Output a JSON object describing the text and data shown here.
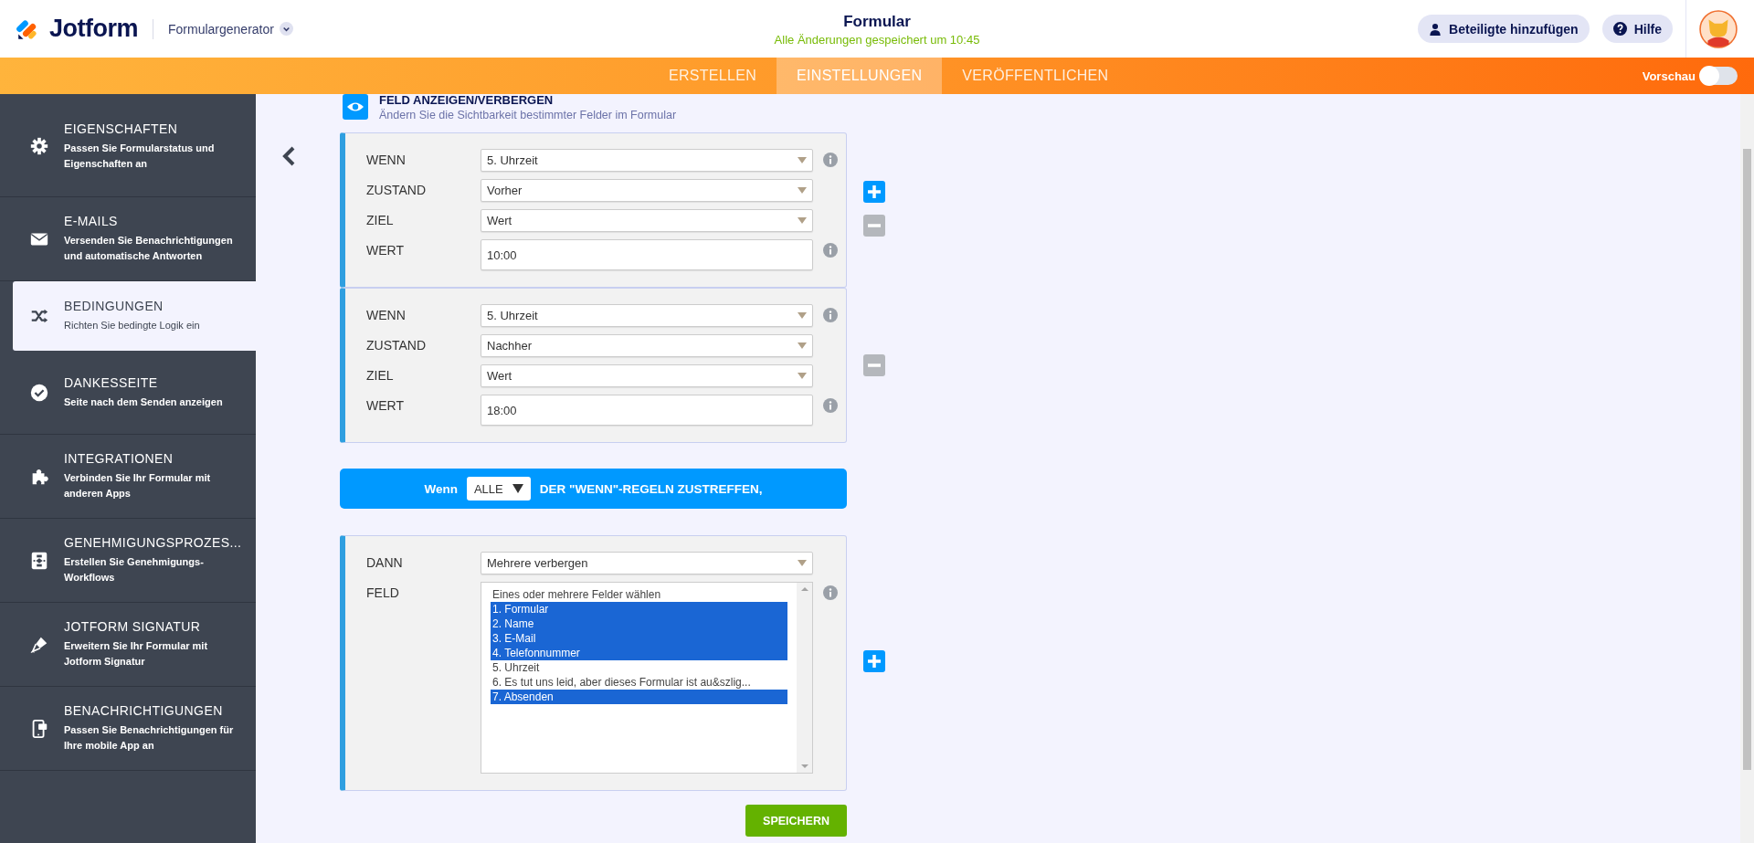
{
  "header": {
    "logo": "Jotform",
    "product": "Formulargenerator",
    "title": "Formular",
    "saved_status": "Alle Änderungen gespeichert um 10:45",
    "buttons": [
      {
        "label": "Beteiligte hinzufügen",
        "kind": "person"
      },
      {
        "label": "Hilfe",
        "kind": "help"
      }
    ]
  },
  "nav_tabs": [
    {
      "label": "ERSTELLEN",
      "selected": false
    },
    {
      "label": "EINSTELLUNGEN",
      "selected": true
    },
    {
      "label": "VERÖFFENTLICHEN",
      "selected": false
    }
  ],
  "preview": {
    "label": "Vorschau",
    "on": false
  },
  "sidebar": {
    "items": [
      {
        "title": "EIGENSCHAFTEN",
        "description": "Passen Sie Formularstatus und Eigenschaften an",
        "selected": false
      },
      {
        "title": "E-MAILS",
        "description": "Versenden Sie Benachrichtigungen und automatische Antworten",
        "selected": false
      },
      {
        "title": "BEDINGUNGEN",
        "description": "Richten Sie bedingte Logik ein",
        "selected": true
      },
      {
        "title": "DANKESSEITE",
        "description": "Seite nach dem Senden anzeigen",
        "selected": false
      },
      {
        "title": "INTEGRATIONEN",
        "description": "Verbinden Sie Ihr Formular mit anderen Apps",
        "selected": false
      },
      {
        "title": "GENEHMIGUNGSPROZES...",
        "description": "Erstellen Sie Genehmigungs-Workflows",
        "selected": false
      },
      {
        "title": "JOTFORM SIGNATUR",
        "description": "Erweitern Sie Ihr Formular mit Jotform Signatur",
        "selected": false
      },
      {
        "title": "BENACHRICHTIGUNGEN",
        "description": "Passen Sie Benachrichtigungen für Ihre mobile App an",
        "selected": false
      }
    ]
  },
  "section": {
    "title": "FELD ANZEIGEN/VERBERGEN",
    "description": "Ändern Sie die Sichtbarkeit bestimmter Felder im Formular"
  },
  "conditions": [
    {
      "add": true,
      "remove": true,
      "fields": [
        {
          "label": "WENN",
          "kind": "select",
          "value": "5. Uhrzeit",
          "info": true
        },
        {
          "label": "ZUSTAND",
          "kind": "select",
          "value": "Vorher",
          "info": false
        },
        {
          "label": "ZIEL",
          "kind": "select",
          "value": "Wert",
          "info": false
        },
        {
          "label": "WERT",
          "kind": "input",
          "value": "10:00",
          "info": true
        }
      ]
    },
    {
      "add": false,
      "remove": true,
      "fields": [
        {
          "label": "WENN",
          "kind": "select",
          "value": "5. Uhrzeit",
          "info": true
        },
        {
          "label": "ZUSTAND",
          "kind": "select",
          "value": "Nachher",
          "info": false
        },
        {
          "label": "ZIEL",
          "kind": "select",
          "value": "Wert",
          "info": false
        },
        {
          "label": "WERT",
          "kind": "input",
          "value": "18:00",
          "info": true
        }
      ]
    }
  ],
  "match_bar": {
    "prefix": "Wenn",
    "select": "ALLE",
    "suffix": "DER \"WENN\"-REGELN ZUSTREFFEN,"
  },
  "action": {
    "add": true,
    "fields": [
      {
        "label": "DANN",
        "kind": "select",
        "value": "Mehrere verbergen",
        "info": false
      },
      {
        "label": "FELD",
        "kind": "listbox",
        "info": true,
        "options": [
          {
            "label": "Eines oder mehrere Felder wählen",
            "selected": false
          },
          {
            "label": "1. Formular",
            "selected": true
          },
          {
            "label": "2. Name",
            "selected": true
          },
          {
            "label": "3. E-Mail",
            "selected": true
          },
          {
            "label": "4. Telefonnummer",
            "selected": true
          },
          {
            "label": "5. Uhrzeit",
            "selected": false
          },
          {
            "label": "6. Es tut uns leid, aber dieses Formular ist au&szlig...",
            "selected": false
          },
          {
            "label": "7. Absenden",
            "selected": true
          }
        ]
      }
    ]
  },
  "save_button": "SPEICHERN"
}
